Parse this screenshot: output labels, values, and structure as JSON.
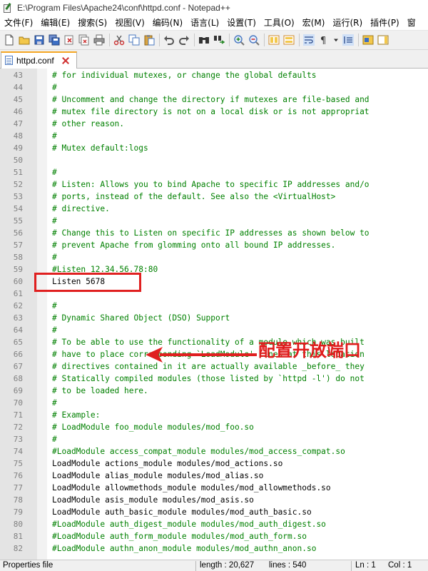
{
  "window": {
    "title": "E:\\Program Files\\Apache24\\conf\\httpd.conf - Notepad++"
  },
  "menu": {
    "items": [
      "文件(F)",
      "编辑(E)",
      "搜索(S)",
      "视图(V)",
      "编码(N)",
      "语言(L)",
      "设置(T)",
      "工具(O)",
      "宏(M)",
      "运行(R)",
      "插件(P)",
      "窗"
    ]
  },
  "toolbar": {
    "icons": [
      "new-file-icon",
      "open-file-icon",
      "save-icon",
      "save-all-icon",
      "close-icon",
      "close-all-icon",
      "print-icon",
      "cut-icon",
      "copy-icon",
      "paste-icon",
      "undo-icon",
      "redo-icon",
      "find-icon",
      "replace-icon",
      "zoom-in-icon",
      "zoom-out-icon",
      "sync-vertical-icon",
      "sync-horizontal-icon",
      "word-wrap-icon",
      "show-all-chars-icon",
      "indent-guide-icon",
      "macro-icon",
      "document-map-icon"
    ]
  },
  "tab": {
    "label": "httpd.conf"
  },
  "editor": {
    "lines": [
      {
        "n": "43",
        "text": "# for individual mutexes, or change the global defaults",
        "comment": true
      },
      {
        "n": "44",
        "text": "#",
        "comment": true
      },
      {
        "n": "45",
        "text": "# Uncomment and change the directory if mutexes are file-based and",
        "comment": true
      },
      {
        "n": "46",
        "text": "# mutex file directory is not on a local disk or is not appropriat",
        "comment": true
      },
      {
        "n": "47",
        "text": "# other reason.",
        "comment": true
      },
      {
        "n": "48",
        "text": "#",
        "comment": true
      },
      {
        "n": "49",
        "text": "# Mutex default:logs",
        "comment": true
      },
      {
        "n": "50",
        "text": "",
        "comment": false
      },
      {
        "n": "51",
        "text": "#",
        "comment": true
      },
      {
        "n": "52",
        "text": "# Listen: Allows you to bind Apache to specific IP addresses and/o",
        "comment": true
      },
      {
        "n": "53",
        "text": "# ports, instead of the default. See also the <VirtualHost>",
        "comment": true
      },
      {
        "n": "54",
        "text": "# directive.",
        "comment": true
      },
      {
        "n": "55",
        "text": "#",
        "comment": true
      },
      {
        "n": "56",
        "text": "# Change this to Listen on specific IP addresses as shown below to",
        "comment": true
      },
      {
        "n": "57",
        "text": "# prevent Apache from glomming onto all bound IP addresses.",
        "comment": true
      },
      {
        "n": "58",
        "text": "#",
        "comment": true
      },
      {
        "n": "59",
        "text": "#Listen 12.34.56.78:80",
        "comment": true
      },
      {
        "n": "60",
        "text": "Listen 5678",
        "comment": false
      },
      {
        "n": "61",
        "text": "",
        "comment": false
      },
      {
        "n": "62",
        "text": "#",
        "comment": true
      },
      {
        "n": "63",
        "text": "# Dynamic Shared Object (DSO) Support",
        "comment": true
      },
      {
        "n": "64",
        "text": "#",
        "comment": true
      },
      {
        "n": "65",
        "text": "# To be able to use the functionality of a module which was built",
        "comment": true
      },
      {
        "n": "66",
        "text": "# have to place corresponding `LoadModule' lines at this location",
        "comment": true
      },
      {
        "n": "67",
        "text": "# directives contained in it are actually available _before_ they",
        "comment": true
      },
      {
        "n": "68",
        "text": "# Statically compiled modules (those listed by `httpd -l') do not",
        "comment": true
      },
      {
        "n": "69",
        "text": "# to be loaded here.",
        "comment": true
      },
      {
        "n": "70",
        "text": "#",
        "comment": true
      },
      {
        "n": "71",
        "text": "# Example:",
        "comment": true
      },
      {
        "n": "72",
        "text": "# LoadModule foo_module modules/mod_foo.so",
        "comment": true
      },
      {
        "n": "73",
        "text": "#",
        "comment": true
      },
      {
        "n": "74",
        "text": "#LoadModule access_compat_module modules/mod_access_compat.so",
        "comment": true
      },
      {
        "n": "75",
        "text": "LoadModule actions_module modules/mod_actions.so",
        "comment": false
      },
      {
        "n": "76",
        "text": "LoadModule alias_module modules/mod_alias.so",
        "comment": false
      },
      {
        "n": "77",
        "text": "LoadModule allowmethods_module modules/mod_allowmethods.so",
        "comment": false
      },
      {
        "n": "78",
        "text": "LoadModule asis_module modules/mod_asis.so",
        "comment": false
      },
      {
        "n": "79",
        "text": "LoadModule auth_basic_module modules/mod_auth_basic.so",
        "comment": false
      },
      {
        "n": "80",
        "text": "#LoadModule auth_digest_module modules/mod_auth_digest.so",
        "comment": true
      },
      {
        "n": "81",
        "text": "#LoadModule auth_form_module modules/mod_auth_form.so",
        "comment": true
      },
      {
        "n": "82",
        "text": "#LoadModule authn_anon_module modules/mod_authn_anon.so",
        "comment": true
      }
    ]
  },
  "annotation": {
    "text": "配置开放端口",
    "color": "#e01b1b"
  },
  "colors": {
    "comment": "#008000",
    "text": "#000000",
    "tab_accent": "#f5a623"
  },
  "statusbar": {
    "file_type": "Properties file",
    "length": "length : 20,627",
    "lines": "lines : 540",
    "ln": "Ln : 1",
    "col": "Col : 1"
  }
}
